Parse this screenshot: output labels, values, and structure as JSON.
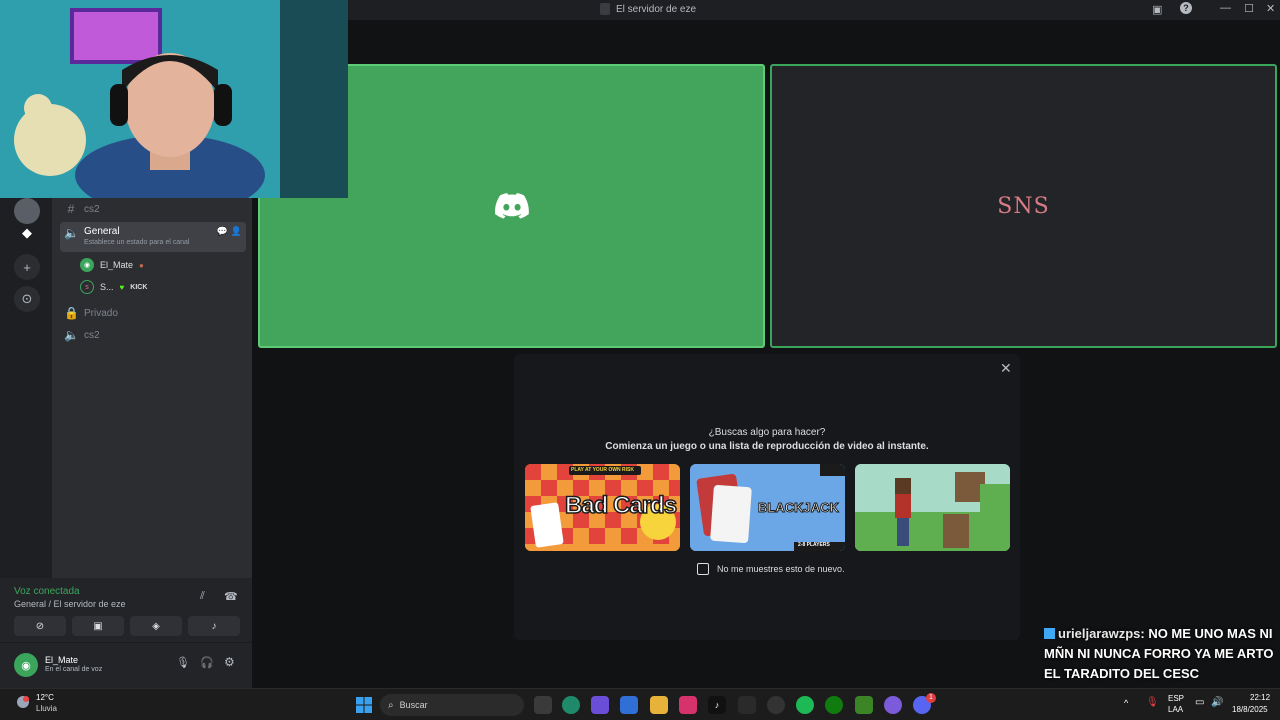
{
  "window": {
    "title": "El servidor de eze"
  },
  "channels": [
    {
      "name": "cs2",
      "type": "text"
    },
    {
      "name": "General",
      "type": "voice",
      "status_placeholder": "Establece un estado para el canal",
      "active": true
    },
    {
      "name": "Privado",
      "type": "locked"
    },
    {
      "name": "cs2",
      "type": "voice"
    }
  ],
  "voice_users": [
    {
      "name": "El_Mate"
    },
    {
      "name": "S...",
      "badge": "KICK"
    }
  ],
  "voice_panel": {
    "status": "Voz conectada",
    "location": "General / El servidor de eze"
  },
  "user_panel": {
    "name": "El_Mate",
    "status": "En el canal de voz"
  },
  "tiles": {
    "tile2_logo": "SNS"
  },
  "activity": {
    "question": "¿Buscas algo para hacer?",
    "subtitle": "Comienza un juego o una lista de reproducción de video al instante.",
    "games": [
      {
        "name": "Bad Cards",
        "tag": "PLAY AT YOUR OWN RISK"
      },
      {
        "name": "BLACKJACK",
        "tag": "2-8 PLAYERS"
      },
      {
        "name": "Minecraft"
      }
    ],
    "dont_show": "No me muestres esto de nuevo."
  },
  "chat": {
    "user": "urieljarawzps",
    "message": ": NO ME UNO MAS NI MÑN NI NUNCA FORRO YA ME ARTO EL TARADITO DEL CESC"
  },
  "taskbar": {
    "weather_temp": "12°C",
    "weather_desc": "Lluvia",
    "search_placeholder": "Buscar",
    "lang_top": "ESP",
    "lang_bottom": "LAA",
    "time": "22:12",
    "date": "18/8/2025",
    "discord_badge": "1"
  },
  "colors": {
    "accent_green": "#43a55c",
    "tile_border": "#3ba55c",
    "panel_bg": "#17181b"
  }
}
